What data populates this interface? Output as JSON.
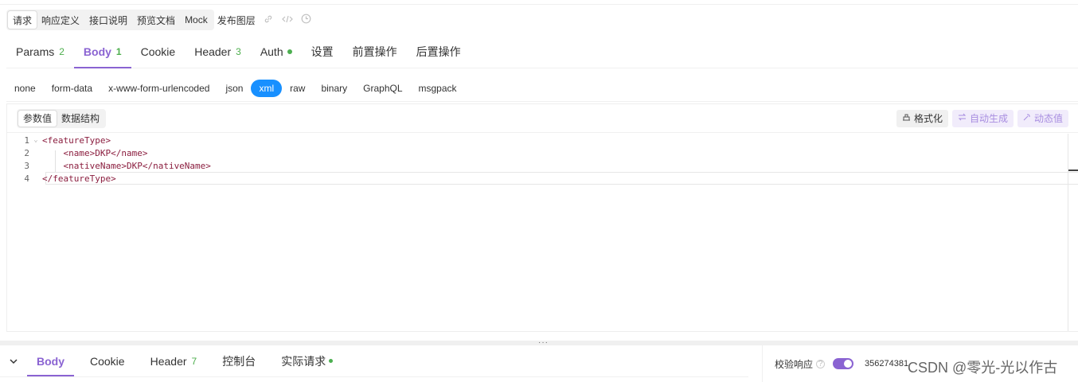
{
  "toolbar": {
    "segments": [
      {
        "label": "请求",
        "active": true
      },
      {
        "label": "响应定义"
      },
      {
        "label": "接口说明"
      },
      {
        "label": "预览文档"
      },
      {
        "label": "Mock"
      }
    ],
    "publish_label": "发布图层",
    "icons": [
      "link-icon",
      "code-icon",
      "history-icon"
    ]
  },
  "tabs": [
    {
      "label": "Params",
      "badge": "2"
    },
    {
      "label": "Body",
      "badge": "1",
      "active": true
    },
    {
      "label": "Cookie"
    },
    {
      "label": "Header",
      "badge": "3"
    },
    {
      "label": "Auth",
      "dot": true
    },
    {
      "label": "设置"
    },
    {
      "label": "前置操作"
    },
    {
      "label": "后置操作"
    }
  ],
  "body_types": [
    "none",
    "form-data",
    "x-www-form-urlencoded",
    "json",
    "xml",
    "raw",
    "binary",
    "GraphQL",
    "msgpack"
  ],
  "body_type_selected": "xml",
  "editor_head": {
    "modes": [
      {
        "label": "参数值",
        "active": true
      },
      {
        "label": "数据结构"
      }
    ],
    "format_label": "格式化",
    "auto_gen_label": "自动生成",
    "dynamic_label": "动态值"
  },
  "code_lines": [
    {
      "n": "1",
      "text": "<featureType>"
    },
    {
      "n": "2",
      "text": "    <name>DKP</name>"
    },
    {
      "n": "3",
      "text": "    <nativeName>DKP</nativeName>"
    },
    {
      "n": "4",
      "text": "</featureType>"
    }
  ],
  "response_tabs": [
    {
      "label": "Body",
      "active": true
    },
    {
      "label": "Cookie"
    },
    {
      "label": "Header",
      "badge": "7"
    },
    {
      "label": "控制台"
    },
    {
      "label": "实际请求",
      "dot": true
    }
  ],
  "validate": {
    "label": "校验响应",
    "enabled": true
  },
  "response_id": "356274381",
  "watermark": "CSDN @零光-光以作古",
  "colors": {
    "accent": "#8a63d2",
    "selected": "#1890ff",
    "badge": "#4cae4c"
  }
}
